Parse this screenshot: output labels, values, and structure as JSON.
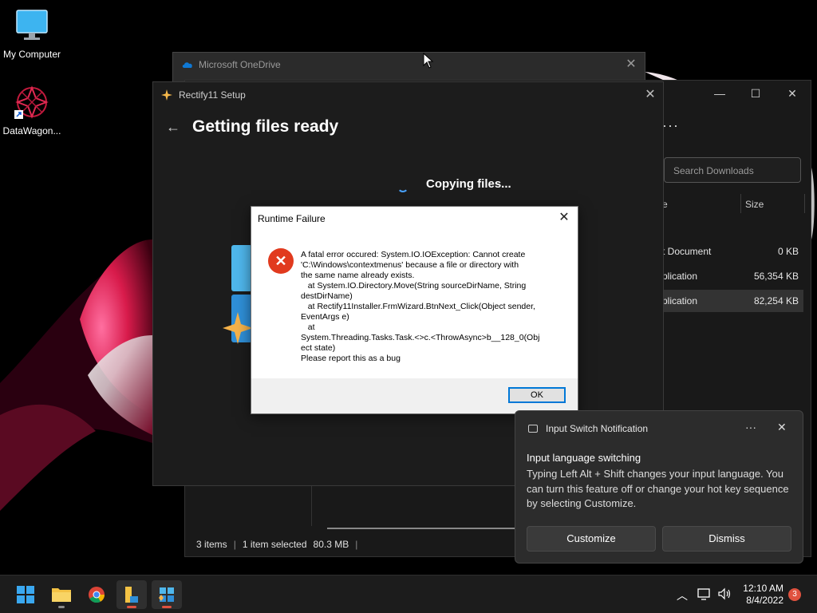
{
  "desktop": {
    "icons": [
      {
        "label": "My Computer"
      },
      {
        "label": "DataWagon..."
      }
    ]
  },
  "onedrive": {
    "title": "Microsoft OneDrive"
  },
  "explorer": {
    "search_placeholder": "Search Downloads",
    "columns": {
      "name_partial": "e",
      "size": "Size"
    },
    "rows": [
      {
        "name": "t Document",
        "size": "0 KB"
      },
      {
        "name": "plication",
        "size": "56,354 KB"
      },
      {
        "name": "plication",
        "size": "82,254 KB"
      }
    ],
    "status": {
      "items": "3 items",
      "selected": "1 item selected",
      "size": "80.3 MB"
    },
    "side_fragment": "lt"
  },
  "setup": {
    "title": "Rectify11 Setup",
    "heading": "Getting files ready",
    "progress_text": "Copying files..."
  },
  "dialog": {
    "title": "Runtime Failure",
    "message": "A fatal error occured: System.IO.IOException: Cannot create\n'C:\\Windows\\contextmenus' because a file or directory with\nthe same name already exists.\n   at System.IO.Directory.Move(String sourceDirName, String\ndestDirName)\n   at Rectify11Installer.FrmWizard.BtnNext_Click(Object sender,\nEventArgs e)\n   at\nSystem.Threading.Tasks.Task.<>c.<ThrowAsync>b__128_0(Obj\nect state)\nPlease report this as a bug",
    "ok_label": "OK"
  },
  "toast": {
    "app": "Input Switch Notification",
    "heading": "Input language switching",
    "body": "Typing Left Alt + Shift changes your input language. You can turn this feature off or change your hot key sequence by selecting Customize.",
    "customize": "Customize",
    "dismiss": "Dismiss"
  },
  "taskbar": {
    "time": "12:10 AM",
    "date": "8/4/2022",
    "notifications": "3"
  }
}
